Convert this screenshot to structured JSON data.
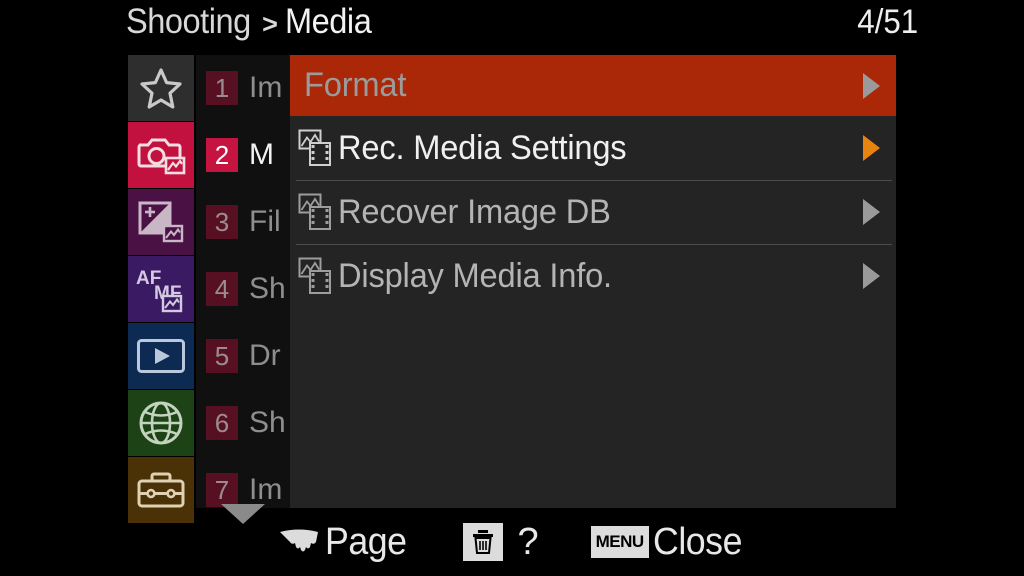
{
  "header": {
    "breadcrumb_parent": "Shooting",
    "breadcrumb_separator": ">",
    "breadcrumb_current": "Media",
    "page_counter": "4/51"
  },
  "sidebar": {
    "icon_tabs": [
      {
        "name": "favorites",
        "icon": "star-icon",
        "color": "#2e2e2e",
        "active": false
      },
      {
        "name": "shooting",
        "icon": "camera-photo-icon",
        "color": "#c2113e",
        "active": true
      },
      {
        "name": "exposure",
        "icon": "exposure-compensation-icon",
        "color": "#4a1244",
        "active": false
      },
      {
        "name": "focus",
        "icon": "af-mf-icon",
        "color": "#3a1a63",
        "active": false
      },
      {
        "name": "playback",
        "icon": "playback-play-icon",
        "color": "#0d2a52",
        "active": false
      },
      {
        "name": "network",
        "icon": "globe-network-icon",
        "color": "#1c4215",
        "active": false
      },
      {
        "name": "setup",
        "icon": "toolbox-setup-icon",
        "color": "#4a3206",
        "active": false
      }
    ],
    "number_tabs": [
      {
        "number": "1",
        "label": "Im",
        "active": false
      },
      {
        "number": "2",
        "label": "M",
        "active": true
      },
      {
        "number": "3",
        "label": "Fil",
        "active": false
      },
      {
        "number": "4",
        "label": "Sh",
        "active": false
      },
      {
        "number": "5",
        "label": "Dr",
        "active": false
      },
      {
        "number": "6",
        "label": "Sh",
        "active": false
      },
      {
        "number": "7",
        "label": "Im",
        "active": false
      }
    ],
    "scroll_down_icon": "chevron-down-icon"
  },
  "menu": {
    "items": [
      {
        "label": "Format",
        "icon": null,
        "selected": true,
        "arrow": "chevron-right-icon",
        "arrow_color": "#9a9a9a",
        "bright": false,
        "divider_above": false
      },
      {
        "label": "Rec. Media Settings",
        "icon": "photo-movie-media-icon",
        "selected": false,
        "arrow": "chevron-right-icon",
        "arrow_color": "#e8830f",
        "bright": true,
        "divider_above": false
      },
      {
        "label": "Recover Image DB",
        "icon": "photo-movie-media-icon",
        "selected": false,
        "arrow": "chevron-right-icon",
        "arrow_color": "#9a9a9a",
        "bright": false,
        "divider_above": true
      },
      {
        "label": "Display Media Info.",
        "icon": "photo-movie-media-icon",
        "selected": false,
        "arrow": "chevron-right-icon",
        "arrow_color": "#9a9a9a",
        "bright": false,
        "divider_above": true
      }
    ]
  },
  "bottom_bar": {
    "page": {
      "icon": "control-dial-icon",
      "label": "Page"
    },
    "help": {
      "icon": "trash-icon",
      "label": "?"
    },
    "close": {
      "icon": "menu-button-badge",
      "badge_text": "MENU",
      "label": "Close"
    }
  },
  "colors": {
    "selection_highlight": "#aa2808",
    "active_tab_red": "#c2113e",
    "panel_background": "#242424",
    "arrow_orange": "#e8830f",
    "screen_background": "#000000"
  }
}
